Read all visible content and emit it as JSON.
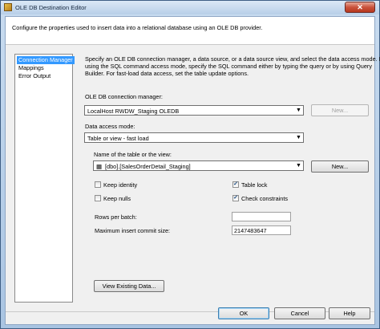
{
  "window": {
    "title": "OLE DB Destination Editor",
    "close": "✕"
  },
  "header": {
    "text": "Configure the properties used to insert data into a relational database using an OLE DB provider."
  },
  "nav": {
    "items": [
      "Connection Manager",
      "Mappings",
      "Error Output"
    ],
    "selected": 0
  },
  "description": {
    "line1": "Specify an OLE DB connection manager, a data source, or a data source view, and select the data access mode. If",
    "line2": "using the SQL command access mode, specify the SQL command either by typing the query or by using Query",
    "line3": "Builder. For fast-load data access, set the table update options."
  },
  "connection": {
    "label": "OLE DB connection manager:",
    "value": "LocalHost RWDW_Staging OLEDB",
    "new_button": "New..."
  },
  "access_mode": {
    "label": "Data access mode:",
    "value": "Table or view - fast load"
  },
  "table": {
    "label": "Name of the table or the view:",
    "value": "[dbo].[SalesOrderDetail_Staging]",
    "new_button": "New..."
  },
  "options": {
    "keep_identity": {
      "label": "Keep identity",
      "checked": false
    },
    "keep_nulls": {
      "label": "Keep nulls",
      "checked": false
    },
    "table_lock": {
      "label": "Table lock",
      "checked": true
    },
    "check_constraints": {
      "label": "Check constraints",
      "checked": true
    },
    "rows_per_batch": {
      "label": "Rows per batch:",
      "value": ""
    },
    "max_insert_commit": {
      "label": "Maximum insert commit size:",
      "value": "2147483647"
    }
  },
  "view_existing_button": "View Existing Data...",
  "footer": {
    "ok": "OK",
    "cancel": "Cancel",
    "help": "Help"
  },
  "check_mark": "✓",
  "icons": {
    "table": "table-icon",
    "dropdown": "chevron-down-icon"
  }
}
